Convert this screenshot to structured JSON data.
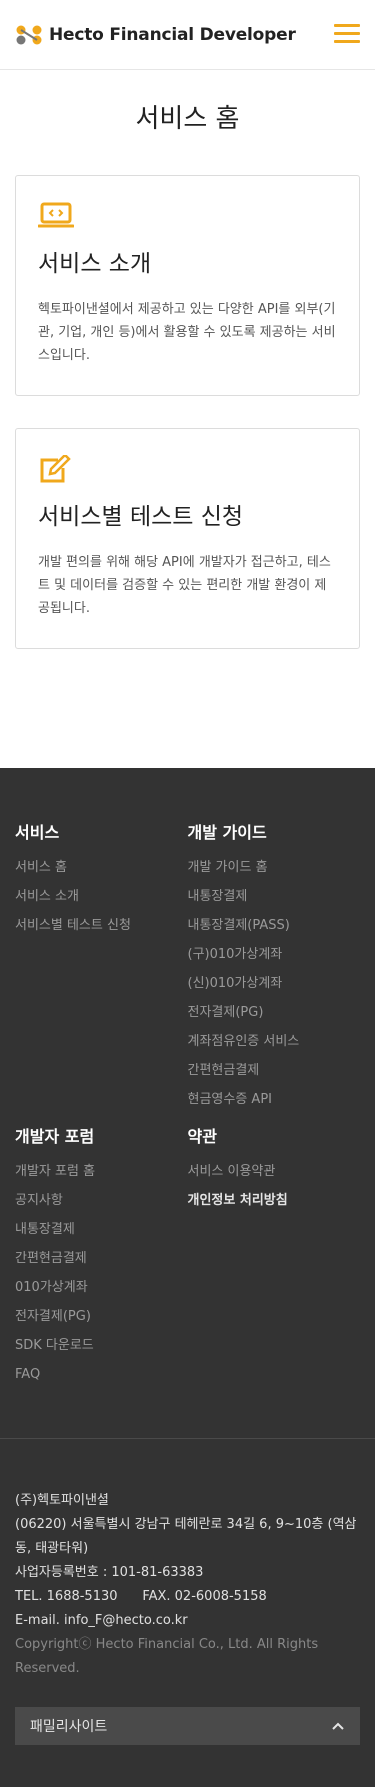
{
  "header": {
    "logo_text": "Hecto Financial Developer"
  },
  "page": {
    "title": "서비스 홈"
  },
  "cards": [
    {
      "title": "서비스 소개",
      "desc": "헥토파이낸셜에서 제공하고 있는 다양한 API를 외부(기관, 기업, 개인 등)에서 활용할 수 있도록 제공하는 서비스입니다."
    },
    {
      "title": "서비스별 테스트 신청",
      "desc": "개발 편의를 위해 해당 API에 개발자가 접근하고, 테스트 및 데이터를 검증할 수 있는 편리한 개발 환경이 제공됩니다."
    }
  ],
  "footer": {
    "service": {
      "heading": "서비스",
      "links": [
        "서비스 홈",
        "서비스 소개",
        "서비스별 테스트 신청"
      ]
    },
    "guide": {
      "heading": "개발 가이드",
      "links": [
        "개발 가이드 홈",
        "내통장결제",
        "내통장결제(PASS)",
        "(구)010가상계좌",
        "(신)010가상계좌",
        "전자결제(PG)",
        "계좌점유인증 서비스",
        "간편현금결제",
        "현금영수증 API"
      ]
    },
    "forum": {
      "heading": "개발자 포럼",
      "links": [
        "개발자 포럼 홈",
        "공지사항",
        "내통장결제",
        "간편현금결제",
        "010가상계좌",
        "전자결제(PG)",
        "SDK 다운로드",
        "FAQ"
      ]
    },
    "terms": {
      "heading": "약관",
      "links": [
        "서비스 이용약관",
        "개인정보 처리방침"
      ]
    },
    "company": "(주)헥토파이낸셜",
    "address": "(06220) 서울특별시 강남구 테헤란로 34길 6, 9~10층 (역삼동, 태광타워)",
    "bizno": "사업자등록번호 : 101-81-63383",
    "tel_fax": "TEL. 1688-5130      FAX. 02-6008-5158",
    "email": "E-mail. info_F@hecto.co.kr",
    "copyright": "Copyrightⓒ Hecto Financial Co., Ltd. All Rights Reserved.",
    "family_site": "패밀리사이트"
  },
  "colors": {
    "accent": "#f0a81c",
    "footer_bg": "#333333"
  }
}
